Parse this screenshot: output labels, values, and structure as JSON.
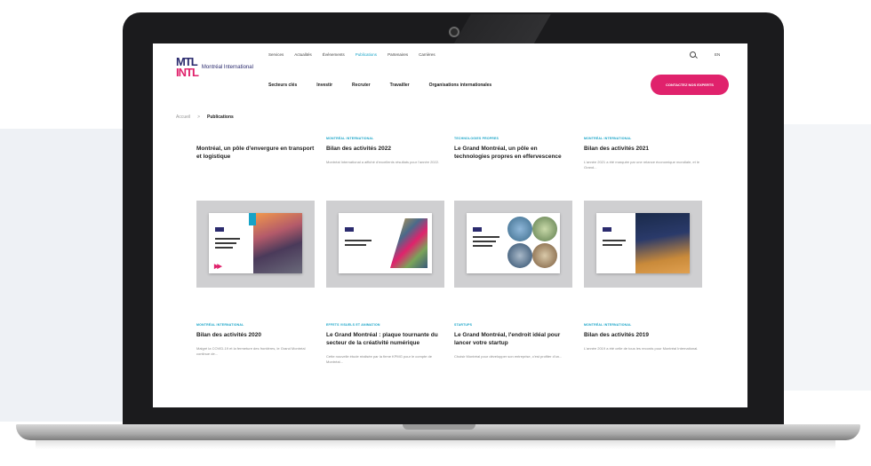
{
  "site": {
    "logo_mark_line1": "MTL",
    "logo_mark_line2": "INTL",
    "logo_text": "Montréal International",
    "topnav": [
      "Services",
      "Actualités",
      "Événements",
      "Publications",
      "Partenaires",
      "Carrières"
    ],
    "active_topnav": "Publications",
    "lang": "EN",
    "mainnav": [
      "Secteurs clés",
      "Investir",
      "Recruter",
      "Travailler",
      "Organisations internationales"
    ],
    "cta_label": "CONTACTEZ NOS EXPERTS",
    "breadcrumb_home": "Accueil",
    "breadcrumb_sep": ">",
    "breadcrumb_current": "Publications"
  },
  "cards_top": [
    {
      "tag": "",
      "title": "Montréal, un pôle d'envergure en transport et logistique",
      "desc": ""
    },
    {
      "tag": "MONTRÉAL INTERNATIONAL",
      "title": "Bilan des activités 2022",
      "desc": "Montréal International a affiché d'excellents résultats pour l'année 2022."
    },
    {
      "tag": "TECHNOLOGIES PROPRES",
      "title": "Le Grand Montréal, un pôle en technologies propres en effervescence",
      "desc": ""
    },
    {
      "tag": "MONTRÉAL INTERNATIONAL",
      "title": "Bilan des activités 2021",
      "desc": "L'année 2021 a été marquée par une relance économique mondiale, et le Grand..."
    }
  ],
  "cards_bottom": [
    {
      "tag": "MONTRÉAL INTERNATIONAL",
      "title": "Bilan des activités 2020",
      "desc": "Malgré la COVID-19 et la fermeture des frontières, le Grand Montréal continue de..."
    },
    {
      "tag": "EFFETS VISUELS ET ANIMATION",
      "title": "Le Grand Montréal : plaque tournante du secteur de la créativité numérique",
      "desc": "Cette nouvelle étude réalisée par la firme KPMG pour le compte de Montréal..."
    },
    {
      "tag": "STARTUPS",
      "title": "Le Grand Montréal, l'endroit idéal pour lancer votre startup",
      "desc": "Choisir Montréal pour développer son entreprise, c'est profiter d'un..."
    },
    {
      "tag": "MONTRÉAL INTERNATIONAL",
      "title": "Bilan des activités 2019",
      "desc": "L'année 2019 a été celle de tous les records pour Montréal International."
    }
  ],
  "colors": {
    "accent_pink": "#e0226c",
    "accent_cyan": "#16a3c7",
    "brand_navy": "#2b2b6e"
  },
  "icons": {
    "search": "search-icon",
    "camera": "camera-icon",
    "arrows": "double-arrow-icon"
  }
}
